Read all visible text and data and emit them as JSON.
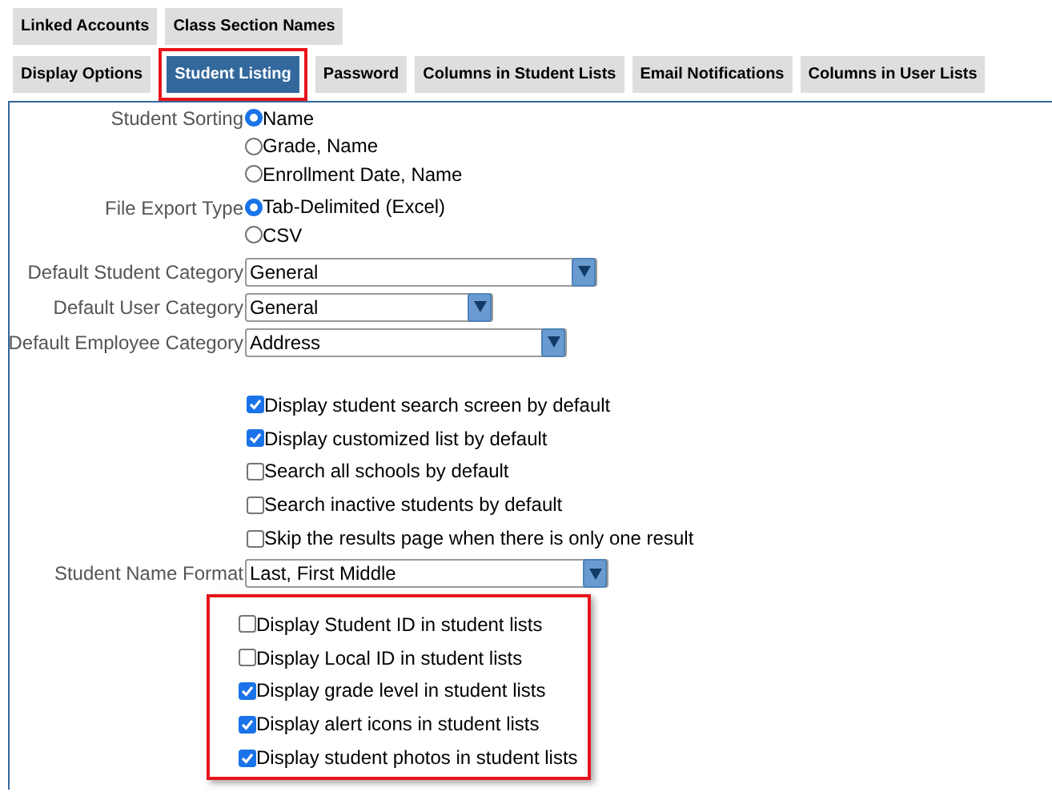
{
  "tab_rows": [
    [
      {
        "label": "Linked Accounts",
        "selected": false,
        "highlighted": false
      },
      {
        "label": "Class Section Names",
        "selected": false,
        "highlighted": false
      }
    ],
    [
      {
        "label": "Display Options",
        "selected": false,
        "highlighted": false
      },
      {
        "label": "Student Listing",
        "selected": true,
        "highlighted": true
      },
      {
        "label": "Password",
        "selected": false,
        "highlighted": false
      },
      {
        "label": "Columns in Student Lists",
        "selected": false,
        "highlighted": false
      },
      {
        "label": "Email Notifications",
        "selected": false,
        "highlighted": false
      },
      {
        "label": "Columns in User Lists",
        "selected": false,
        "highlighted": false
      }
    ]
  ],
  "sections": [
    {
      "kind": "radio",
      "label": "Student Sorting",
      "options": [
        {
          "label": "Name",
          "selected": true
        },
        {
          "label": "Grade, Name",
          "selected": false
        },
        {
          "label": "Enrollment Date, Name",
          "selected": false
        }
      ]
    },
    {
      "kind": "radio",
      "label": "File Export Type",
      "options": [
        {
          "label": "Tab-Delimited (Excel)",
          "selected": true
        },
        {
          "label": "CSV",
          "selected": false
        }
      ]
    },
    {
      "kind": "select",
      "label": "Default Student Category",
      "value": "General"
    },
    {
      "kind": "select",
      "label": "Default User Category",
      "value": "General"
    },
    {
      "kind": "select",
      "label": "Default Employee Category",
      "value": "Address"
    },
    {
      "kind": "checkboxes",
      "options": [
        {
          "label": "Display student search screen by default",
          "checked": true
        },
        {
          "label": "Display customized list by default",
          "checked": true
        },
        {
          "label": "Search all schools by default",
          "checked": false
        },
        {
          "label": "Search inactive students by default",
          "checked": false
        },
        {
          "label": "Skip the results page when there is only one result",
          "checked": false
        }
      ]
    },
    {
      "kind": "select",
      "label": "Student Name Format",
      "value": "Last, First Middle"
    },
    {
      "kind": "checkboxes",
      "highlighted": true,
      "options": [
        {
          "label": "Display Student ID in student lists",
          "checked": false
        },
        {
          "label": "Display Local ID in student lists",
          "checked": false
        },
        {
          "label": "Display grade level in student lists",
          "checked": true
        },
        {
          "label": "Display alert icons in student lists",
          "checked": true
        },
        {
          "label": "Display student photos in student lists",
          "checked": true
        }
      ]
    }
  ]
}
